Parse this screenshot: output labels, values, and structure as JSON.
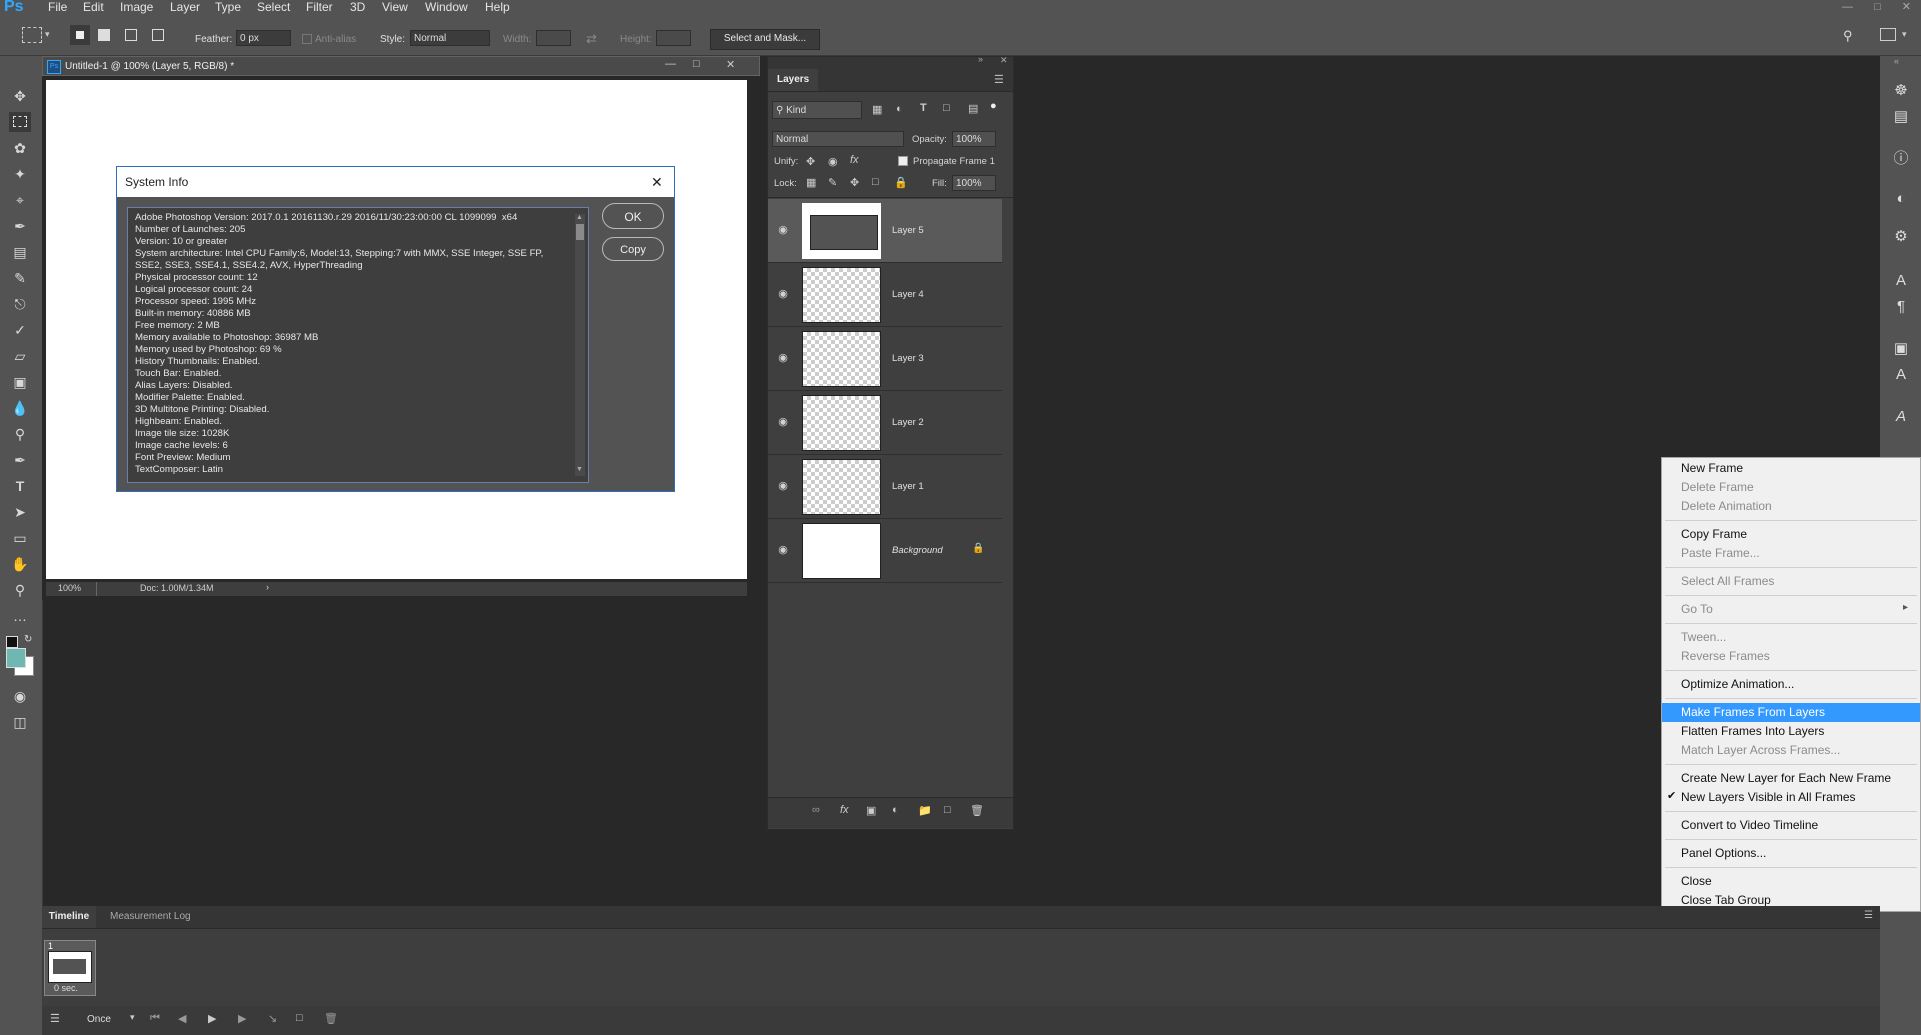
{
  "menubar": {
    "logo": "Ps",
    "items": [
      "File",
      "Edit",
      "Image",
      "Layer",
      "Type",
      "Select",
      "Filter",
      "3D",
      "View",
      "Window",
      "Help"
    ]
  },
  "options": {
    "feather_label": "Feather:",
    "feather_value": "0 px",
    "antialias_label": "Anti-alias",
    "style_label": "Style:",
    "style_value": "Normal",
    "width_label": "Width:",
    "height_label": "Height:",
    "select_mask_label": "Select and Mask..."
  },
  "document": {
    "tab_title": "Untitled-1 @ 100% (Layer 5, RGB/8) *",
    "zoom": "100%",
    "doc_size": "Doc: 1.00M/1.34M"
  },
  "dialog": {
    "title": "System Info",
    "ok_label": "OK",
    "copy_label": "Copy",
    "lines": [
      "Adobe Photoshop Version: 2017.0.1 20161130.r.29 2016/11/30:23:00:00 CL 1099099  x64",
      "Number of Launches: 205",
      "Version: 10 or greater",
      "System architecture: Intel CPU Family:6, Model:13, Stepping:7 with MMX, SSE Integer, SSE FP,",
      "SSE2, SSE3, SSE4.1, SSE4.2, AVX, HyperThreading",
      "Physical processor count: 12",
      "Logical processor count: 24",
      "Processor speed: 1995 MHz",
      "Built-in memory: 40886 MB",
      "Free memory: 2 MB",
      "Memory available to Photoshop: 36987 MB",
      "Memory used by Photoshop: 69 %",
      "History Thumbnails: Enabled.",
      "Touch Bar: Enabled.",
      "Alias Layers: Disabled.",
      "Modifier Palette: Enabled.",
      "3D Multitone Printing: Disabled.",
      "Highbeam: Enabled.",
      "Image tile size: 1028K",
      "Image cache levels: 6",
      "Font Preview: Medium",
      "TextComposer: Latin"
    ]
  },
  "layers_panel": {
    "tab": "Layers",
    "kind_label": "Kind",
    "blend_mode": "Normal",
    "opacity_label": "Opacity:",
    "opacity_value": "100%",
    "unify_label": "Unify:",
    "propagate_label": "Propagate Frame 1",
    "lock_label": "Lock:",
    "fill_label": "Fill:",
    "fill_value": "100%",
    "layers": [
      "Layer 5",
      "Layer 4",
      "Layer 3",
      "Layer 2",
      "Layer 1",
      "Background"
    ]
  },
  "context_menu": {
    "items": [
      {
        "label": "New Frame",
        "state": "enabled"
      },
      {
        "label": "Delete Frame",
        "state": "disabled"
      },
      {
        "label": "Delete Animation",
        "state": "disabled"
      },
      {
        "label": "Copy Frame",
        "state": "enabled"
      },
      {
        "label": "Paste Frame...",
        "state": "disabled"
      },
      {
        "label": "Select All Frames",
        "state": "disabled"
      },
      {
        "label": "Go To",
        "state": "disabled"
      },
      {
        "label": "Tween...",
        "state": "disabled"
      },
      {
        "label": "Reverse Frames",
        "state": "disabled"
      },
      {
        "label": "Optimize Animation...",
        "state": "enabled"
      },
      {
        "label": "Make Frames From Layers",
        "state": "highlighted"
      },
      {
        "label": "Flatten Frames Into Layers",
        "state": "enabled"
      },
      {
        "label": "Match Layer Across Frames...",
        "state": "disabled"
      },
      {
        "label": "Create New Layer for Each New Frame",
        "state": "enabled"
      },
      {
        "label": "New Layers Visible in All Frames",
        "state": "checked"
      },
      {
        "label": "Convert to Video Timeline",
        "state": "enabled"
      },
      {
        "label": "Panel Options...",
        "state": "enabled"
      },
      {
        "label": "Close",
        "state": "enabled"
      },
      {
        "label": "Close Tab Group",
        "state": "enabled"
      }
    ]
  },
  "timeline": {
    "tab_timeline": "Timeline",
    "tab_measurement": "Measurement Log",
    "frame_number": "1",
    "frame_delay": "0 sec.",
    "loop": "Once"
  }
}
